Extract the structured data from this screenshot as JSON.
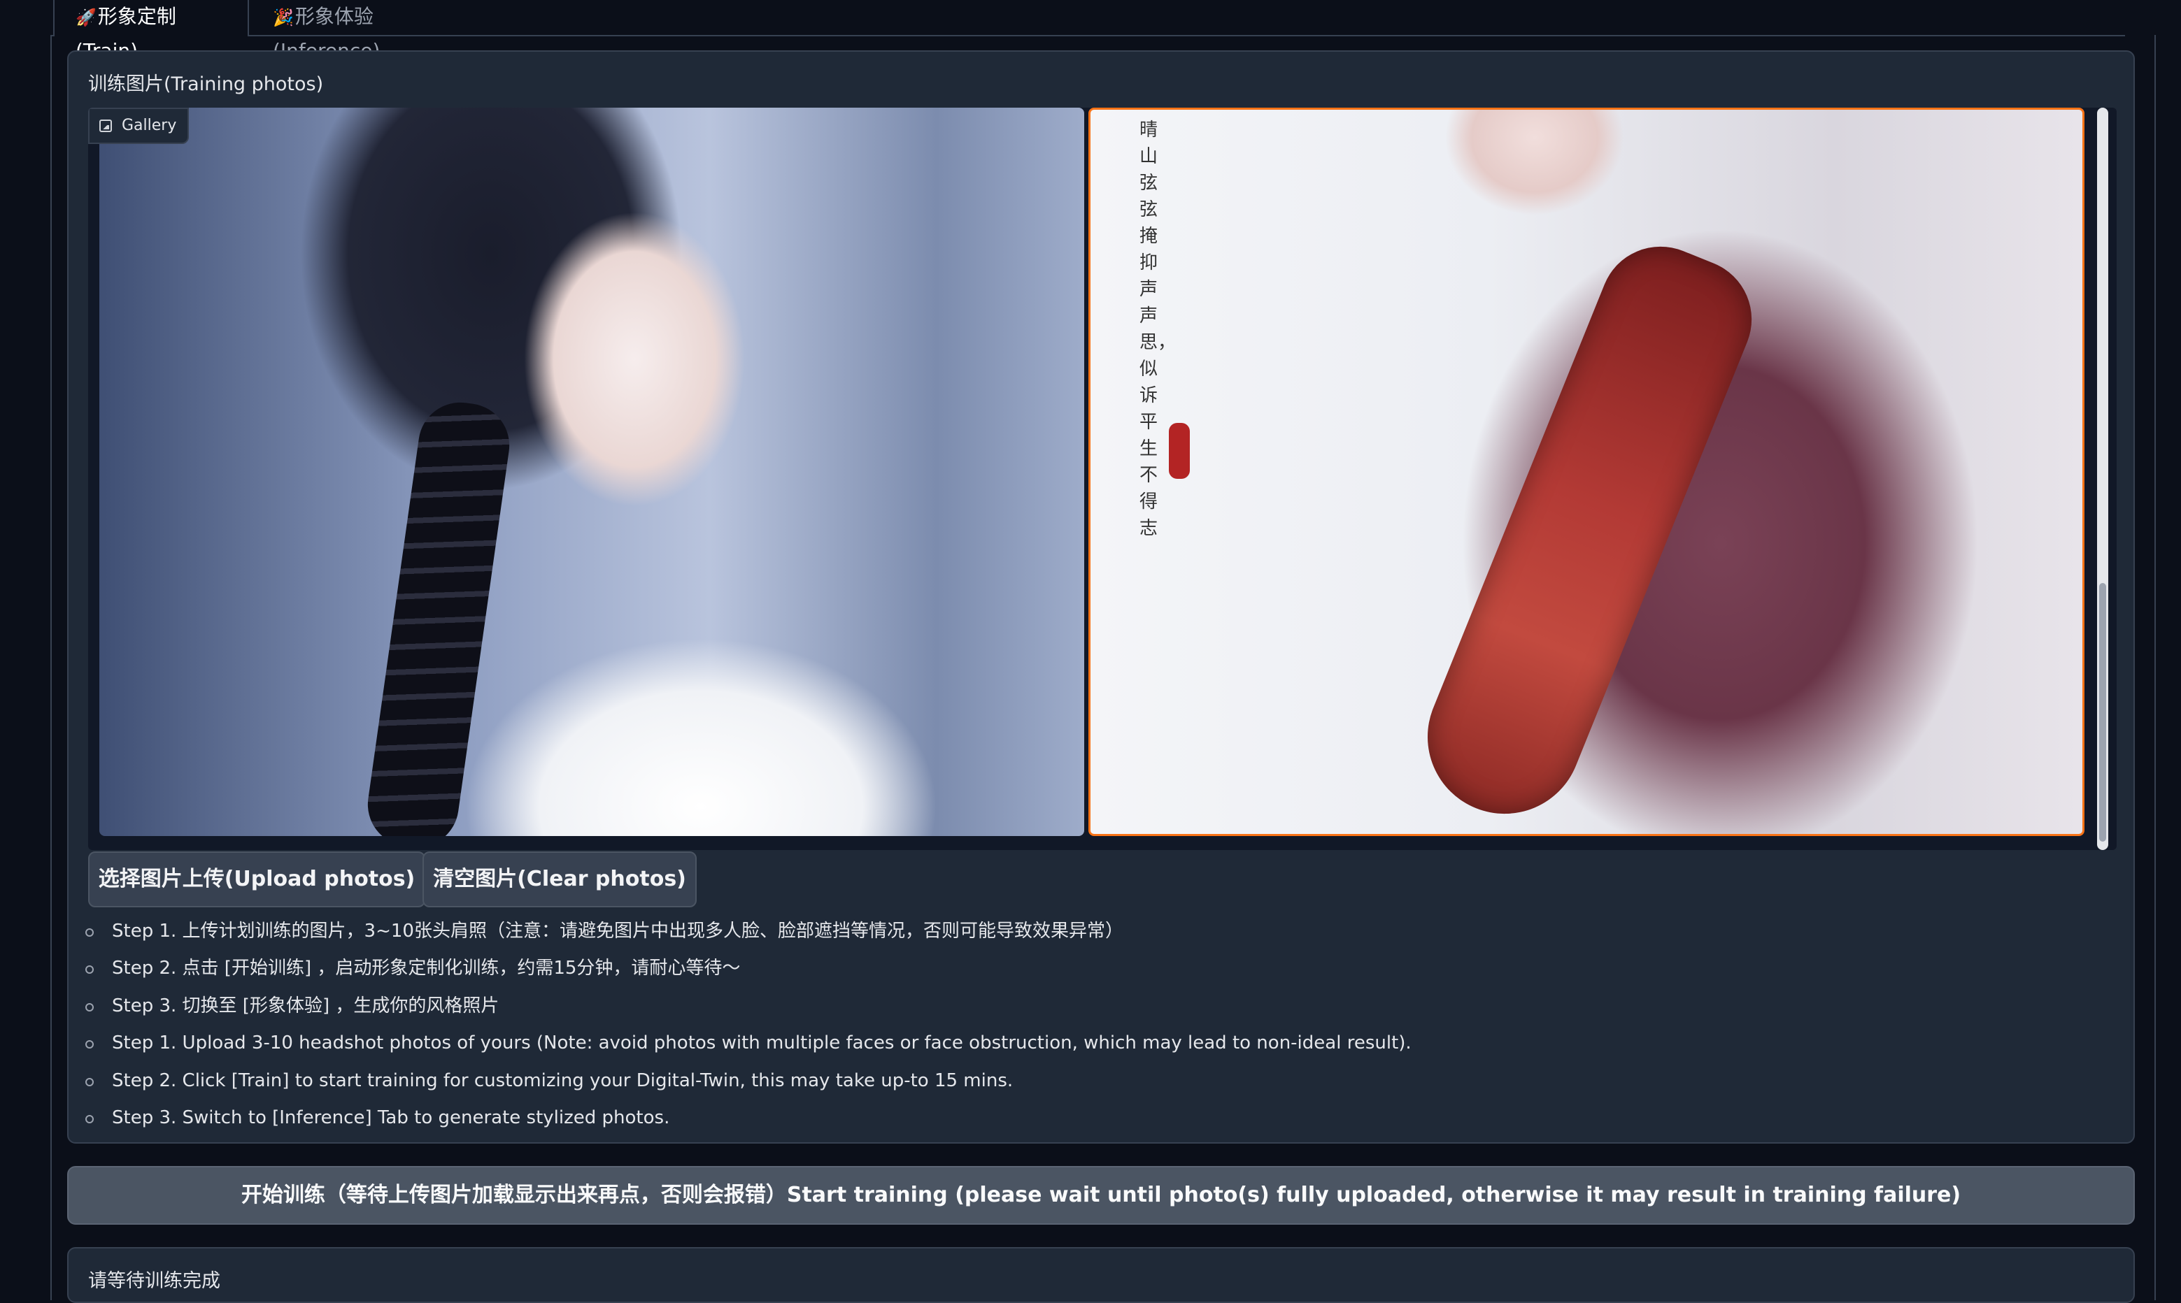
{
  "tabs": [
    {
      "icon": "🚀",
      "label": "形象定制(Train)",
      "active": true
    },
    {
      "icon": "🎉",
      "label": "形象体验(Inference)",
      "active": false
    }
  ],
  "training": {
    "label": "训练图片(Training photos)",
    "gallery_badge": "Gallery",
    "photo2_verse": "晴山弦弦掩抑声声思，似诉平生不得志"
  },
  "buttons": {
    "upload": "选择图片上传(Upload photos)",
    "clear": "清空图片(Clear photos)",
    "train": "开始训练（等待上传图片加载显示出来再点，否则会报错）Start training (please wait until photo(s) fully uploaded, otherwise it may result in training failure)"
  },
  "steps": [
    "Step 1. 上传计划训练的图片，3~10张头肩照（注意：请避免图片中出现多人脸、脸部遮挡等情况，否则可能导致效果异常）",
    "Step 2. 点击 [开始训练] ，启动形象定制化训练，约需15分钟，请耐心等待～",
    "Step 3. 切换至 [形象体验] ，生成你的风格照片",
    "Step 1. Upload 3-10 headshot photos of yours (Note: avoid photos with multiple faces or face obstruction, which may lead to non-ideal result).",
    "Step 2. Click [Train] to start training for customizing your Digital-Twin, this may take up-to 15 mins.",
    "Step 3. Switch to [Inference] Tab to generate stylized photos."
  ],
  "status": {
    "label": "请等待训练完成"
  },
  "colors": {
    "background": "#0b0f19",
    "panel": "#1f2937",
    "selected_photo_border": "#f97316"
  }
}
